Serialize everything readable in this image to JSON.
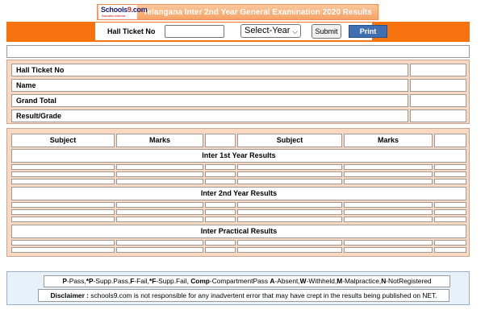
{
  "banner": {
    "logo_text_a": "Schools",
    "logo_text_b": "9",
    "logo_text_c": ".com",
    "logo_tagline": "Education Informer",
    "title": "Telangana Inter 2nd Year General Examination 2020 Results"
  },
  "search": {
    "hall_ticket_label": "Hall Ticket No",
    "hall_ticket_value": "",
    "year_select_value": "Select-Year",
    "submit_label": "Submit",
    "print_label": "Print"
  },
  "info": {
    "rows": [
      {
        "label": "Hall Ticket No",
        "value": ""
      },
      {
        "label": "Name",
        "value": ""
      },
      {
        "label": "Grand Total",
        "value": ""
      },
      {
        "label": "Result/Grade",
        "value": ""
      }
    ]
  },
  "results": {
    "headers": [
      "Subject",
      "Marks",
      "",
      "Subject",
      "Marks",
      ""
    ],
    "sections": [
      {
        "title": "Inter 1st Year Results"
      },
      {
        "title": "Inter 2nd Year Results"
      },
      {
        "title": "Inter Practical Results"
      }
    ]
  },
  "legend": {
    "p": "P",
    "p_text": "-Pass,",
    "sp": "*P",
    "sp_text": "-Supp.Pass,",
    "f": "F",
    "f_text": "-Fail,",
    "sf": "*F",
    "sf_text": "-Supp.Fail, ",
    "comp": "Comp",
    "comp_text": "-CompartmentPass ",
    "a": "A",
    "a_text": "-Absent,",
    "w": "W",
    "w_text": "-Withheld,",
    "m": "M",
    "m_text": "-Malpractice,",
    "n": "N",
    "n_text": "-NotRegistered"
  },
  "disclaimer": {
    "label": "Disclaimer :",
    "text": " schools9.com is not responsible for any inadvertent error that may have crept in the results being published on NET."
  }
}
